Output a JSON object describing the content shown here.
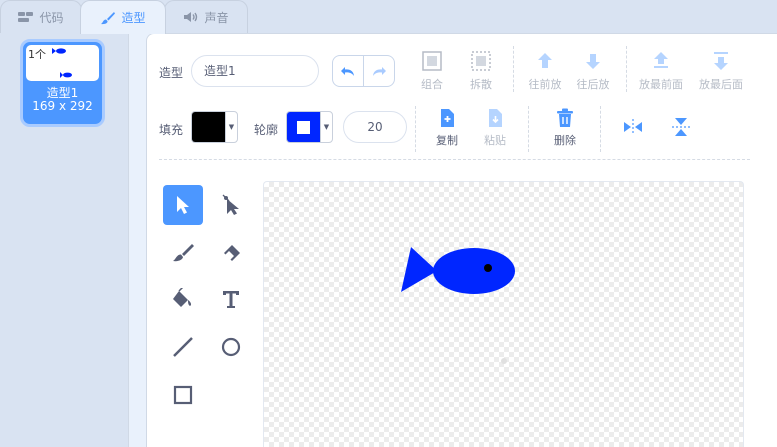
{
  "tabs": [
    {
      "label": "代码",
      "icon": "code-icon"
    },
    {
      "label": "造型",
      "icon": "brush-icon"
    },
    {
      "label": "声音",
      "icon": "speaker-icon"
    }
  ],
  "costume_list": {
    "items": [
      {
        "badge": "1个",
        "name": "造型1",
        "size": "169 x 292"
      }
    ]
  },
  "editor": {
    "costume_label": "造型",
    "costume_name": "造型1",
    "fill_label": "填充",
    "outline_label": "轮廓",
    "fill_color": "#000000",
    "outline_color": "#0026ff",
    "stroke_width": "20",
    "group_label": "组合",
    "ungroup_label": "拆散",
    "forward_label": "往前放",
    "backward_label": "往后放",
    "front_label": "放最前面",
    "back_label": "放最后面",
    "copy_label": "复制",
    "paste_label": "粘贴",
    "delete_label": "删除"
  },
  "colors": {
    "accent": "#4c97ff",
    "fish": "#0026ff",
    "text": "#575e75",
    "disabled": "#b5bbc6"
  }
}
